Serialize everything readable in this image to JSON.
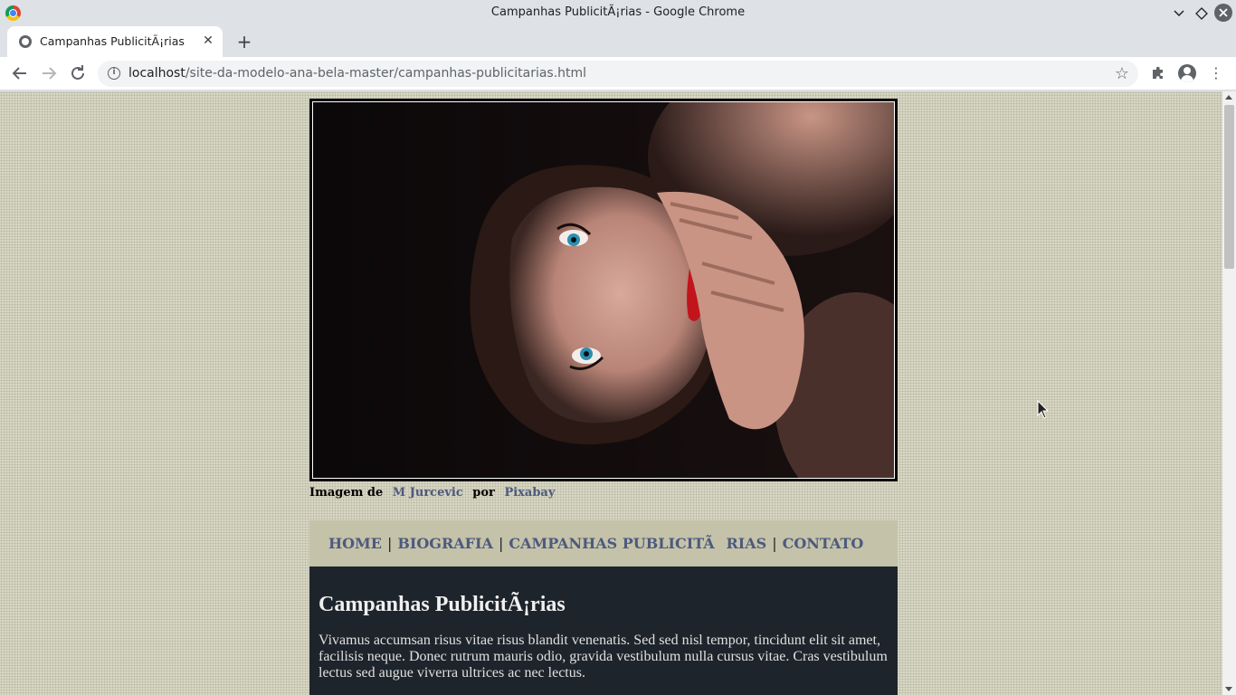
{
  "window": {
    "title": "Campanhas PublicitÃ¡rias - Google Chrome"
  },
  "tab": {
    "title": "Campanhas PublicitÃ¡rias",
    "close": "✕",
    "new_tab": "+"
  },
  "toolbar": {
    "back": "←",
    "forward": "→",
    "reload": "↻",
    "url_host": "localhost",
    "url_path": "/site-da-modelo-ana-bela-master/campanhas-publicitarias.html",
    "bookmark": "☆",
    "extensions": "✱",
    "menu": "⋮"
  },
  "page": {
    "credit": {
      "prefix": "Imagem de",
      "author": "M Jurcevic",
      "middle": "por",
      "source": "Pixabay"
    },
    "nav": [
      {
        "label": "HOME"
      },
      {
        "label": "BIOGRAFIA"
      },
      {
        "label": "CAMPANHAS PUBLICITÃRIAS"
      },
      {
        "label": "CONTATO"
      }
    ],
    "separator": "|",
    "heading": "Campanhas PublicitÃ¡rias",
    "paragraph": "Vivamus accumsan risus vitae risus blandit venenatis. Sed sed nisl tempor, tincidunt elit sit amet, facilisis neque. Donec rutrum mauris odio, gravida vestibulum nulla cursus vitae. Cras vestibulum lectus sed augue viverra ultrices ac nec lectus."
  },
  "colors": {
    "nav_link": "#4d5a7e",
    "nav_bg": "#c4c2a8",
    "content_bg": "#1e242b"
  }
}
